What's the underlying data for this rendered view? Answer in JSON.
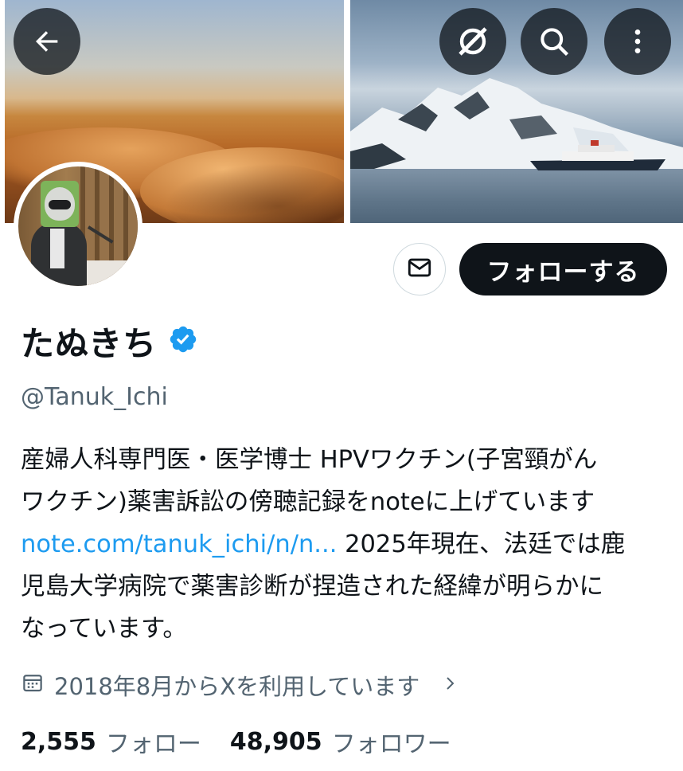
{
  "header": {
    "back_icon": "arrow-left-icon",
    "grok_icon": "grok-icon",
    "search_icon": "search-icon",
    "more_icon": "more-vertical-icon"
  },
  "profile": {
    "display_name": "たぬきち",
    "verified": true,
    "verified_color": "#1d9bf0",
    "handle": "@Tanuk_Ichi",
    "bio": {
      "line1": "産婦人科専門医・医学博士 HPVワクチン(子宮頸がん",
      "line2": "ワクチン)薬害訴訟の傍聴記録をnoteに上げています",
      "link": "note.com/tanuk_ichi/n/n...",
      "line3_rest": " 2025年現在、法廷では鹿",
      "line4": "児島大学病院で薬害診断が捏造された経緯が明らかに",
      "line5": "なっています。"
    },
    "joined": "2018年8月からXを利用しています",
    "following_count": "2,555",
    "following_label": "フォロー",
    "followers_count": "48,905",
    "followers_label": "フォロワー"
  },
  "actions": {
    "message_icon": "mail-icon",
    "follow_label": "フォローする"
  },
  "colors": {
    "text_primary": "#0f1419",
    "text_secondary": "#536471",
    "link": "#1d9bf0",
    "button_dark": "#0f1419"
  }
}
